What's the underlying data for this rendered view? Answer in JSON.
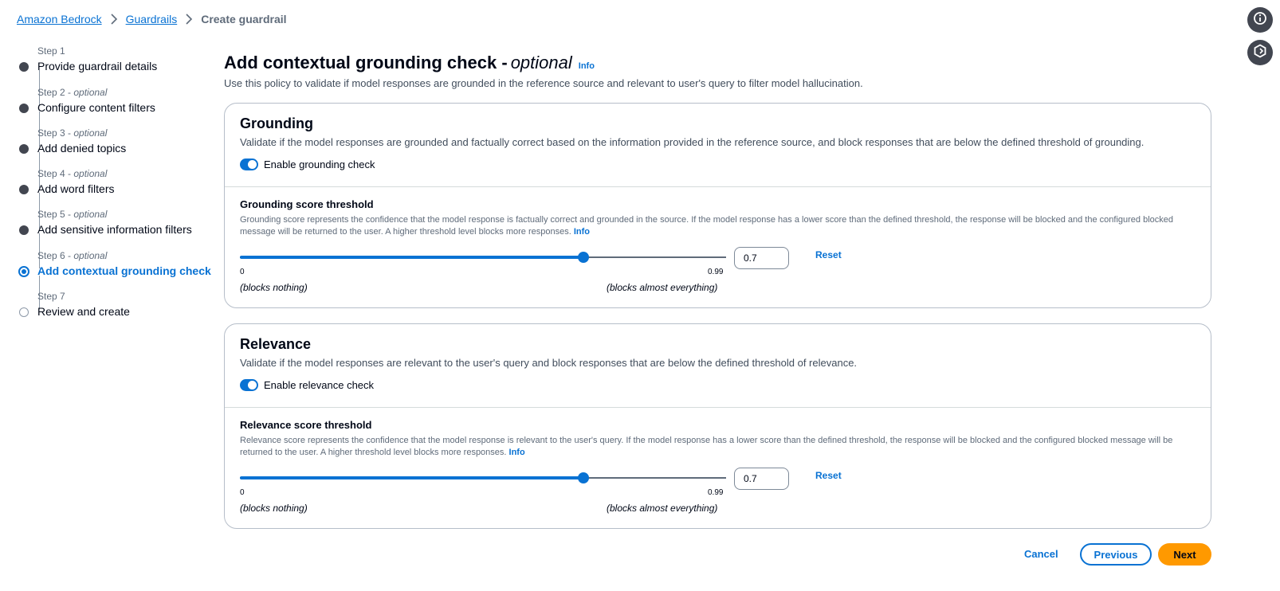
{
  "breadcrumb": {
    "items": [
      "Amazon Bedrock",
      "Guardrails"
    ],
    "current": "Create guardrail"
  },
  "utility": {
    "icons": [
      "info-icon",
      "hexagon-settings-icon"
    ]
  },
  "steps": [
    {
      "number": "Step 1",
      "optional": "",
      "title": "Provide guardrail details",
      "state": "complete"
    },
    {
      "number": "Step 2 - ",
      "optional": "optional",
      "title": "Configure content filters",
      "state": "complete"
    },
    {
      "number": "Step 3 - ",
      "optional": "optional",
      "title": "Add denied topics",
      "state": "complete"
    },
    {
      "number": "Step 4 - ",
      "optional": "optional",
      "title": "Add word filters",
      "state": "complete"
    },
    {
      "number": "Step 5 - ",
      "optional": "optional",
      "title": "Add sensitive information filters",
      "state": "complete"
    },
    {
      "number": "Step 6 - ",
      "optional": "optional",
      "title": "Add contextual grounding check",
      "state": "active"
    },
    {
      "number": "Step 7",
      "optional": "",
      "title": "Review and create",
      "state": "future"
    }
  ],
  "header": {
    "title": "Add contextual grounding check - ",
    "title_optional": "optional",
    "info": "Info",
    "description": "Use this policy to validate if model responses are grounded in the reference source and relevant to user's query to filter model hallucination."
  },
  "grounding": {
    "title": "Grounding",
    "description": "Validate if the model responses are grounded and factually correct based on the information provided in the reference source, and block responses that are below the defined threshold of grounding.",
    "toggle_label": "Enable grounding check",
    "toggle_on": true,
    "threshold_title": "Grounding score threshold",
    "threshold_desc": "Grounding score represents the confidence that the model response is factually correct and grounded in the source. If the model response has a lower score than the defined threshold, the response will be blocked and the configured blocked message will be returned to the user. A higher threshold level blocks more responses.",
    "info": "Info",
    "slider_value": 0.7,
    "slider_max": 0.99,
    "min_tick": "0",
    "max_tick": "0.99",
    "min_label": "(blocks nothing)",
    "max_label": "(blocks almost everything)",
    "input_value": "0.7",
    "reset": "Reset"
  },
  "relevance": {
    "title": "Relevance",
    "description": "Validate if the model responses are relevant to the user's query and block responses that are below the defined threshold of relevance.",
    "toggle_label": "Enable relevance check",
    "toggle_on": true,
    "threshold_title": "Relevance score threshold",
    "threshold_desc": "Relevance score represents the confidence that the model response is relevant to the user's query. If the model response has a lower score than the defined threshold, the response will be blocked and the configured blocked message will be returned to the user. A higher threshold level blocks more responses.",
    "info": "Info",
    "slider_value": 0.7,
    "slider_max": 0.99,
    "min_tick": "0",
    "max_tick": "0.99",
    "min_label": "(blocks nothing)",
    "max_label": "(blocks almost everything)",
    "input_value": "0.7",
    "reset": "Reset"
  },
  "footer": {
    "cancel": "Cancel",
    "previous": "Previous",
    "next": "Next"
  },
  "colors": {
    "accent": "#0972d3",
    "primary_button": "#ff9900"
  }
}
